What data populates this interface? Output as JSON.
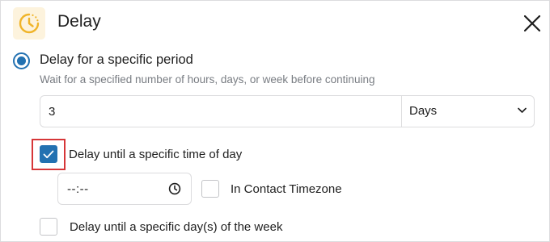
{
  "header": {
    "title": "Delay",
    "icon": "clock-icon",
    "icon_color": "#f0b429",
    "icon_bg": "#fdf3dd"
  },
  "delay_period": {
    "label": "Delay for a specific period",
    "description": "Wait for a specified number of hours, days, or week before continuing",
    "selected": true,
    "amount": "3",
    "unit": "Days"
  },
  "time_of_day": {
    "label": "Delay until a specific time of day",
    "checked": true,
    "time_value": "--:--",
    "timezone_label": "In Contact Timezone",
    "timezone_checked": false
  },
  "day_of_week": {
    "label": "Delay until a specific day(s) of the week",
    "checked": false
  },
  "colors": {
    "accent": "#2271b1",
    "highlight": "#d63638",
    "muted_text": "#787c82",
    "border": "#dcdcde"
  }
}
